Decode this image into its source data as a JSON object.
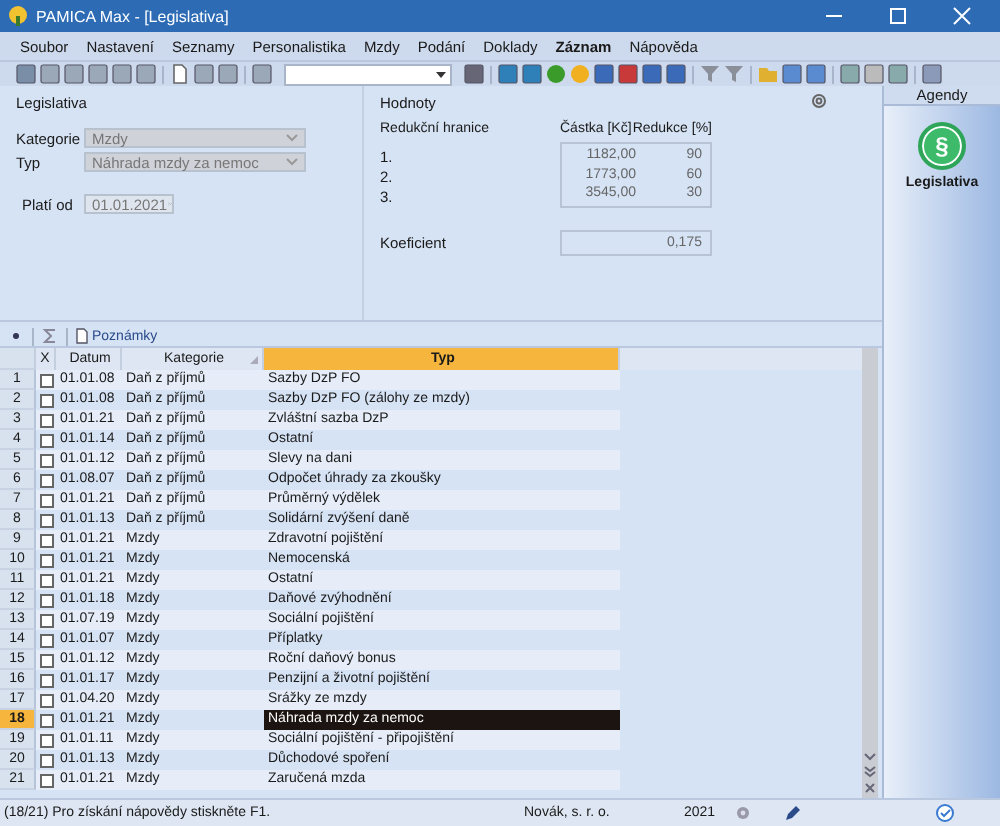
{
  "window": {
    "title": "PAMICA Max - [Legislativa]"
  },
  "menu": [
    {
      "label": "Soubor",
      "active": false
    },
    {
      "label": "Nastavení",
      "active": false
    },
    {
      "label": "Seznamy",
      "active": false
    },
    {
      "label": "Personalistika",
      "active": false
    },
    {
      "label": "Mzdy",
      "active": false
    },
    {
      "label": "Podání",
      "active": false
    },
    {
      "label": "Doklady",
      "active": false
    },
    {
      "label": "Záznam",
      "active": true
    },
    {
      "label": "Nápověda",
      "active": false
    }
  ],
  "legislativa": {
    "title": "Legislativa",
    "fields": [
      {
        "label": "Kategorie",
        "value": "Mzdy",
        "disabled": true
      },
      {
        "label": "Typ",
        "value": "Náhrada mzdy za nemoc",
        "disabled": true
      }
    ],
    "date": {
      "label": "Platí od",
      "value": "01.01.2021",
      "disabled": true
    }
  },
  "hodnoty": {
    "title": "Hodnoty",
    "columns": [
      "Redukční hranice",
      "Částka [Kč]",
      "Redukce [%]"
    ],
    "rows": [
      {
        "label": "1.",
        "amount": "1182,00",
        "reduction": "90"
      },
      {
        "label": "2.",
        "amount": "1773,00",
        "reduction": "60"
      },
      {
        "label": "3.",
        "amount": "3545,00",
        "reduction": "30"
      }
    ],
    "coefficient": {
      "label": "Koeficient",
      "value": "0,175"
    }
  },
  "grid": {
    "tab": "Poznámky",
    "columns": [
      "X",
      "Datum",
      "Kategorie",
      "Typ"
    ],
    "rows": [
      {
        "number": "1",
        "checked": false,
        "date": "01.01.08",
        "category": "Daň z příjmů",
        "type": "Sazby DzP FO",
        "selected": false
      },
      {
        "number": "2",
        "checked": false,
        "date": "01.01.08",
        "category": "Daň z příjmů",
        "type": "Sazby DzP FO (zálohy ze mzdy)",
        "selected": false
      },
      {
        "number": "3",
        "checked": false,
        "date": "01.01.21",
        "category": "Daň z příjmů",
        "type": "Zvláštní sazba DzP",
        "selected": false
      },
      {
        "number": "4",
        "checked": false,
        "date": "01.01.14",
        "category": "Daň z příjmů",
        "type": "Ostatní",
        "selected": false
      },
      {
        "number": "5",
        "checked": false,
        "date": "01.01.12",
        "category": "Daň z příjmů",
        "type": "Slevy na dani",
        "selected": false
      },
      {
        "number": "6",
        "checked": false,
        "date": "01.08.07",
        "category": "Daň z příjmů",
        "type": "Odpočet úhrady za zkoušky",
        "selected": false
      },
      {
        "number": "7",
        "checked": false,
        "date": "01.01.21",
        "category": "Daň z příjmů",
        "type": "Průměrný výdělek",
        "selected": false
      },
      {
        "number": "8",
        "checked": false,
        "date": "01.01.13",
        "category": "Daň z příjmů",
        "type": "Solidární zvýšení daně",
        "selected": false
      },
      {
        "number": "9",
        "checked": false,
        "date": "01.01.21",
        "category": "Mzdy",
        "type": "Zdravotní pojištění",
        "selected": false
      },
      {
        "number": "10",
        "checked": false,
        "date": "01.01.21",
        "category": "Mzdy",
        "type": "Nemocenská",
        "selected": false
      },
      {
        "number": "11",
        "checked": false,
        "date": "01.01.21",
        "category": "Mzdy",
        "type": "Ostatní",
        "selected": false
      },
      {
        "number": "12",
        "checked": false,
        "date": "01.01.18",
        "category": "Mzdy",
        "type": "Daňové zvýhodnění",
        "selected": false
      },
      {
        "number": "13",
        "checked": false,
        "date": "01.07.19",
        "category": "Mzdy",
        "type": "Sociální pojištění",
        "selected": false
      },
      {
        "number": "14",
        "checked": false,
        "date": "01.01.07",
        "category": "Mzdy",
        "type": "Příplatky",
        "selected": false
      },
      {
        "number": "15",
        "checked": false,
        "date": "01.01.12",
        "category": "Mzdy",
        "type": "Roční daňový bonus",
        "selected": false
      },
      {
        "number": "16",
        "checked": false,
        "date": "01.01.17",
        "category": "Mzdy",
        "type": "Penzijní a životní pojištění",
        "selected": false
      },
      {
        "number": "17",
        "checked": false,
        "date": "01.04.20",
        "category": "Mzdy",
        "type": "Srážky ze mzdy",
        "selected": false
      },
      {
        "number": "18",
        "checked": false,
        "date": "01.01.21",
        "category": "Mzdy",
        "type": "Náhrada mzdy za nemoc",
        "selected": true
      },
      {
        "number": "19",
        "checked": false,
        "date": "01.01.11",
        "category": "Mzdy",
        "type": "Sociální pojištění - připojištění",
        "selected": false
      },
      {
        "number": "20",
        "checked": false,
        "date": "01.01.13",
        "category": "Mzdy",
        "type": "Důchodové spoření",
        "selected": false
      },
      {
        "number": "21",
        "checked": false,
        "date": "01.01.21",
        "category": "Mzdy",
        "type": "Zaručená mzda",
        "selected": false
      }
    ]
  },
  "agendy": {
    "title": "Agendy",
    "items": [
      {
        "icon": "§",
        "label": "Legislativa",
        "selected": true
      }
    ]
  },
  "status_bar": {
    "message": "(18/21) Pro získání nápovědy stiskněte F1.",
    "company": "Novák, s. r. o.",
    "year": "2021"
  }
}
